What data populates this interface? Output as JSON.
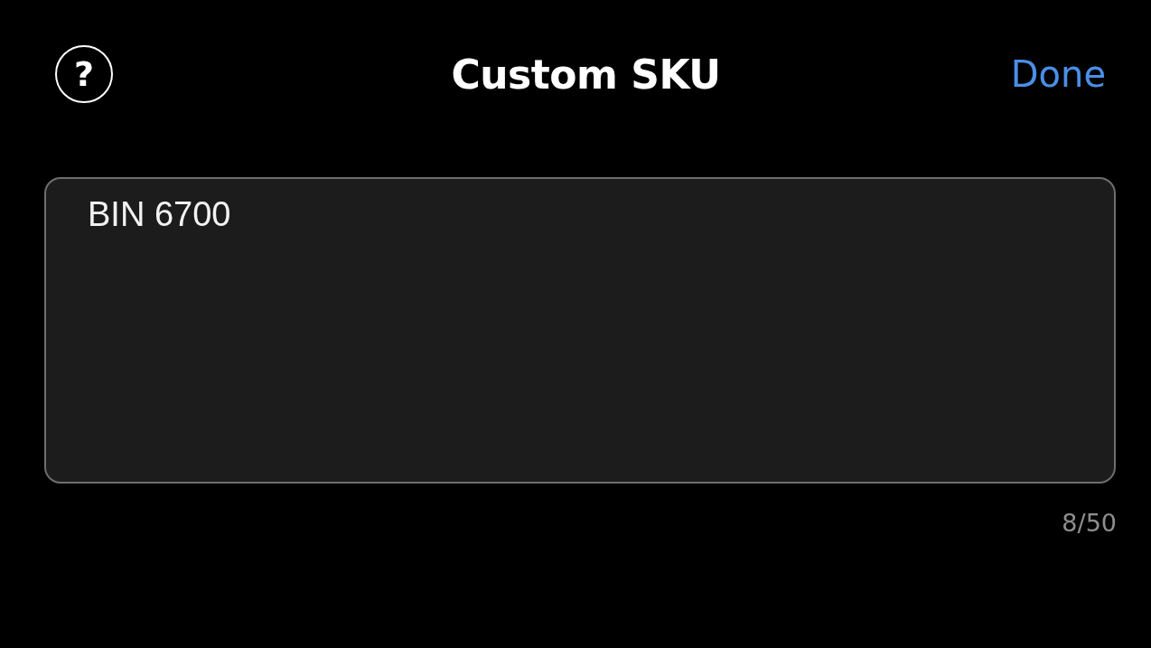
{
  "header": {
    "help_icon": "?",
    "title": "Custom SKU",
    "done_button": "Done"
  },
  "sku_field": {
    "value": "BIN 6700"
  },
  "character_count": "8/50"
}
